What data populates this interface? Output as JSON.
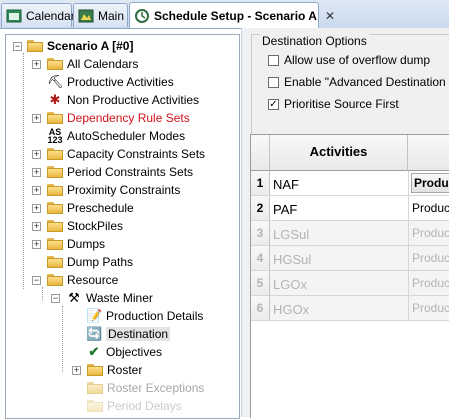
{
  "tabs": [
    {
      "label": "Calendar",
      "icon": "calendar-icon"
    },
    {
      "label": "Main",
      "icon": "main-window-icon"
    },
    {
      "label": "Schedule Setup - Scenario A",
      "icon": "schedule-setup-icon",
      "active": true
    }
  ],
  "tab_close": "✕",
  "tree": {
    "root": "Scenario A [#0]",
    "items": [
      {
        "label": "All Calendars"
      },
      {
        "label": "Productive Activities"
      },
      {
        "label": "Non Productive Activities"
      },
      {
        "label": "Dependency Rule Sets"
      },
      {
        "label": "AutoScheduler Modes"
      },
      {
        "label": "Capacity Constraints Sets"
      },
      {
        "label": "Period Constraints Sets"
      },
      {
        "label": "Proximity Constraints"
      },
      {
        "label": "Preschedule"
      },
      {
        "label": "StockPiles"
      },
      {
        "label": "Dumps"
      },
      {
        "label": "Dump Paths"
      },
      {
        "label": "Resource"
      },
      {
        "label": "Waste Miner"
      },
      {
        "label": "Production Details"
      },
      {
        "label": "Destination"
      },
      {
        "label": "Objectives"
      },
      {
        "label": "Roster"
      },
      {
        "label": "Roster Exceptions"
      },
      {
        "label": "Period Delays"
      }
    ]
  },
  "destination_options": {
    "title": "Destination Options",
    "options": [
      {
        "label": "Allow use of overflow dump",
        "checked": false
      },
      {
        "label": "Enable \"Advanced Destination Se",
        "checked": false
      },
      {
        "label": "Prioritise Source First",
        "checked": true
      }
    ]
  },
  "grid": {
    "header": "Activities",
    "rows": [
      {
        "num": "1",
        "name": "NAF",
        "prod": "Produ",
        "enabled": true
      },
      {
        "num": "2",
        "name": "PAF",
        "prod": "Produc",
        "enabled": true
      },
      {
        "num": "3",
        "name": "LGSul",
        "prod": "Produc",
        "enabled": false
      },
      {
        "num": "4",
        "name": "HGSul",
        "prod": "Produc",
        "enabled": false
      },
      {
        "num": "5",
        "name": "LGOx",
        "prod": "Produc",
        "enabled": false
      },
      {
        "num": "6",
        "name": "HGOx",
        "prod": "Produc",
        "enabled": false
      }
    ]
  },
  "colors": {
    "dependency_rule_sets": "#d0121b",
    "disabled_text": "#b4b4b4",
    "tab_bar": "#c9d9ee"
  }
}
